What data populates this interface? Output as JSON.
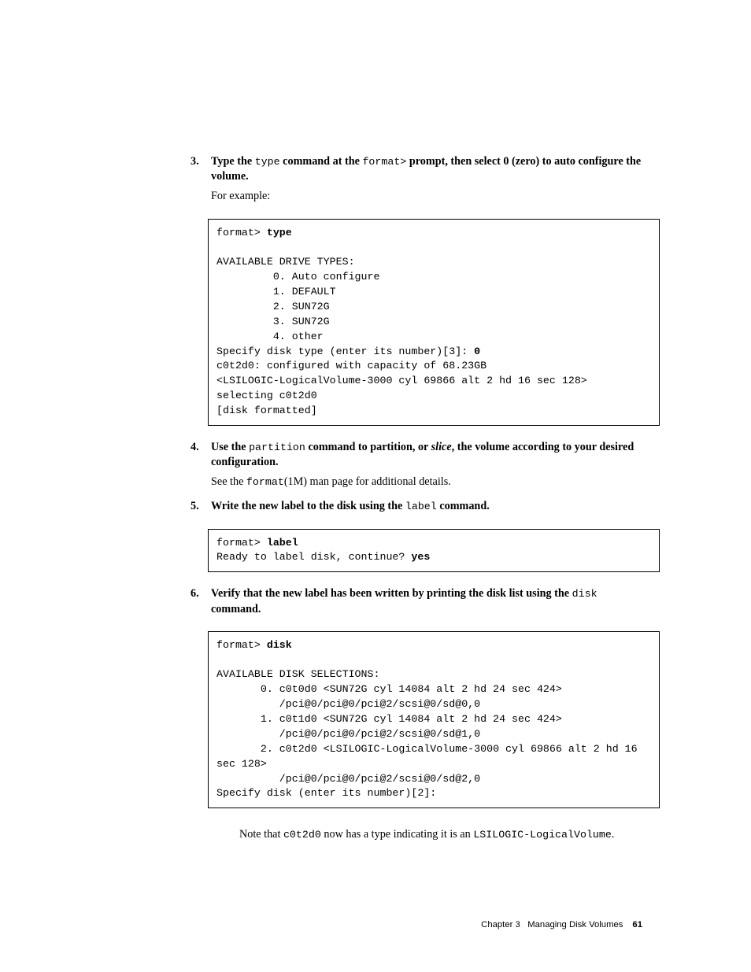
{
  "steps": {
    "s3": {
      "num": "3.",
      "instr_parts": {
        "t1": "Type the ",
        "code1": "type",
        "t2": " command at the ",
        "code2": "format>",
        "t3": " prompt, then select 0 (zero) to auto configure the volume."
      },
      "followup": "For example:"
    },
    "s4": {
      "num": "4.",
      "instr_parts": {
        "t1": "Use the ",
        "code1": "partition",
        "t2": " command to partition, or ",
        "em1": "slice",
        "t3": ", the volume according to your desired configuration."
      },
      "followup_pre": "See the ",
      "followup_code": "format",
      "followup_paren": "(1M)",
      "followup_post": " man page for additional details."
    },
    "s5": {
      "num": "5.",
      "instr_parts": {
        "t1": "Write the new label to the disk using the ",
        "code1": "label",
        "t2": " command."
      }
    },
    "s6": {
      "num": "6.",
      "instr_parts": {
        "t1": "Verify that the new label has been written by printing the disk list using the ",
        "code1": "disk",
        "t2": " command."
      }
    }
  },
  "code1": {
    "l0a": "format> ",
    "l0b": "type",
    "l1": "",
    "l2": "AVAILABLE DRIVE TYPES:",
    "l3": "         0. Auto configure",
    "l4": "         1. DEFAULT",
    "l5": "         2. SUN72G",
    "l6": "         3. SUN72G",
    "l7": "         4. other",
    "l8a": "Specify disk type (enter its number)[3]: ",
    "l8b": "0",
    "l9": "c0t2d0: configured with capacity of 68.23GB",
    "l10": "<LSILOGIC-LogicalVolume-3000 cyl 69866 alt 2 hd 16 sec 128>",
    "l11": "selecting c0t2d0",
    "l12": "[disk formatted]"
  },
  "code2": {
    "l0a": "format> ",
    "l0b": "label",
    "l1a": "Ready to label disk, continue? ",
    "l1b": "yes"
  },
  "code3": {
    "l0a": "format> ",
    "l0b": "disk",
    "l1": "",
    "l2": "AVAILABLE DISK SELECTIONS:",
    "l3": "       0. c0t0d0 <SUN72G cyl 14084 alt 2 hd 24 sec 424>",
    "l4": "          /pci@0/pci@0/pci@2/scsi@0/sd@0,0",
    "l5": "       1. c0t1d0 <SUN72G cyl 14084 alt 2 hd 24 sec 424>",
    "l6": "          /pci@0/pci@0/pci@2/scsi@0/sd@1,0",
    "l7": "       2. c0t2d0 <LSILOGIC-LogicalVolume-3000 cyl 69866 alt 2 hd 16 sec 128>",
    "l8": "          /pci@0/pci@0/pci@2/scsi@0/sd@2,0",
    "l9": "Specify disk (enter its number)[2]:"
  },
  "note": {
    "t1": "Note that ",
    "code1": "c0t2d0",
    "t2": " now has a type indicating it is an ",
    "code2": "LSILOGIC-LogicalVolume",
    "t3": "."
  },
  "footer": {
    "chapter": "Chapter 3",
    "title": "Managing Disk Volumes",
    "page": "61"
  }
}
